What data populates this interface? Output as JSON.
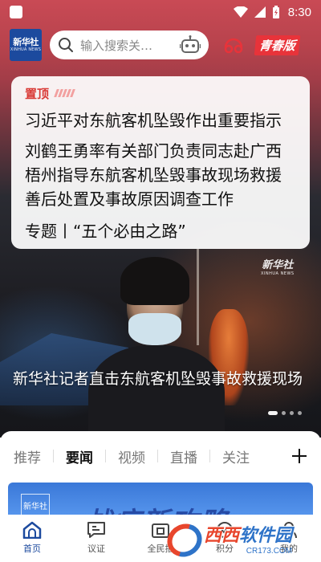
{
  "status_bar": {
    "time": "8:30"
  },
  "app": {
    "logo_cn": "新华社",
    "logo_en": "XINHUA NEWS"
  },
  "top_bar": {
    "search_placeholder": "输入搜索关…",
    "youth_mode_label": "青春版"
  },
  "headline_card": {
    "pin_label": "置顶",
    "headlines": [
      "习近平对东航客机坠毁作出重要指示",
      "刘鹤王勇率有关部门负责同志赴广西梧州指导东航客机坠毁事故现场救援善后处置及事故原因调查工作",
      "专题丨“五个必由之路”"
    ]
  },
  "video": {
    "watermark_cn": "新华社",
    "watermark_en": "XINHUA NEWS",
    "caption": "新华社记者直击东航客机坠毁事故救援现场"
  },
  "carousel": {
    "count": 4,
    "active_index": 0
  },
  "channel_tabs": [
    "推荐",
    "要闻",
    "视频",
    "直播",
    "关注"
  ],
  "channel_tabs_active": "要闻",
  "banner": {
    "logo": "新华社",
    "text": "战疫新攻略"
  },
  "bottom_nav": [
    {
      "label": "首页",
      "icon": "home-icon",
      "active": true
    },
    {
      "label": "议证",
      "icon": "chat-icon",
      "active": false
    },
    {
      "label": "全民拍",
      "icon": "camera-icon",
      "active": false
    },
    {
      "label": "积分",
      "icon": "points-icon",
      "active": false
    },
    {
      "label": "我的",
      "icon": "user-icon",
      "active": false
    }
  ],
  "site_watermark": {
    "text_part1": "西西",
    "text_part2": "软件园",
    "url": "CR173.COM"
  },
  "colors": {
    "brand_blue": "#1c4a9e",
    "pin_red": "#d93a36",
    "youth_red": "#e8333a",
    "hero_top": "#c94a55"
  }
}
